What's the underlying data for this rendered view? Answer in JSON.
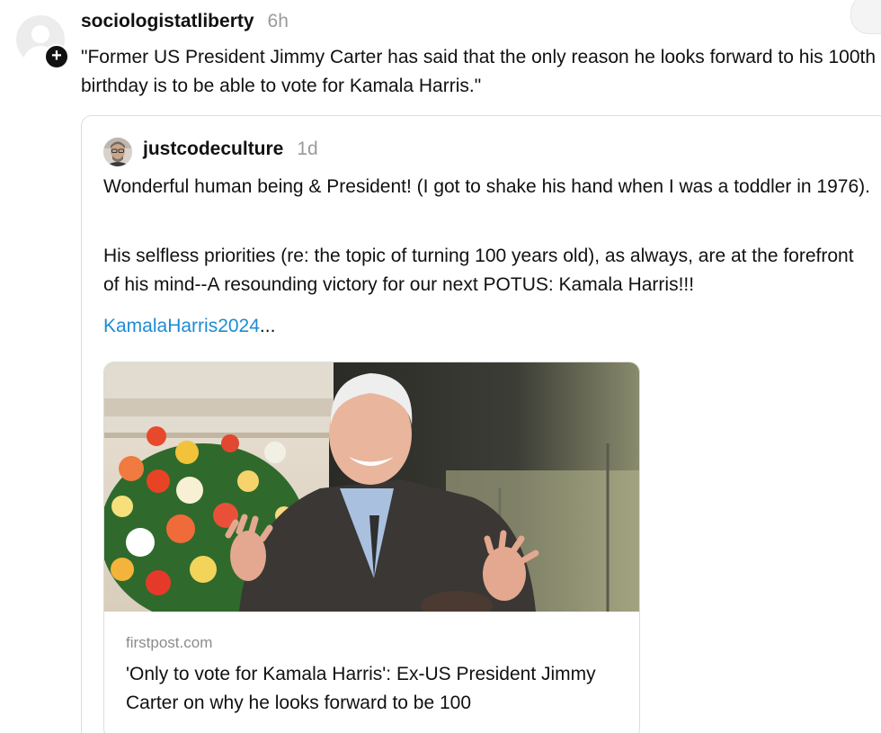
{
  "post": {
    "username": "sociologistatliberty",
    "timestamp": "6h",
    "text": "\"Former US President Jimmy Carter has said that the only reason he looks forward to his 100th birthday is to be able to vote for Kamala Harris.\"",
    "follow_icon": "plus-icon"
  },
  "quoted_post": {
    "username": "justcodeculture",
    "timestamp": "1d",
    "paragraphs": [
      "Wonderful human being & President! (I got to shake his hand when I was a toddler in 1976).",
      "His selfless priorities (re: the topic of turning 100 years old), as always, are at the forefront of his mind--A resounding victory for our next POTUS: Kamala Harris!!!"
    ],
    "hashtag": "KamalaHarris2024",
    "truncation": "...",
    "link_preview": {
      "domain": "firstpost.com",
      "title": "'Only to vote for Kamala Harris': Ex-US President Jimmy Carter on why he looks forward to be 100"
    }
  },
  "colors": {
    "link": "#1d8cd3",
    "muted": "#9a9a9a",
    "border": "#dcdcdc"
  }
}
